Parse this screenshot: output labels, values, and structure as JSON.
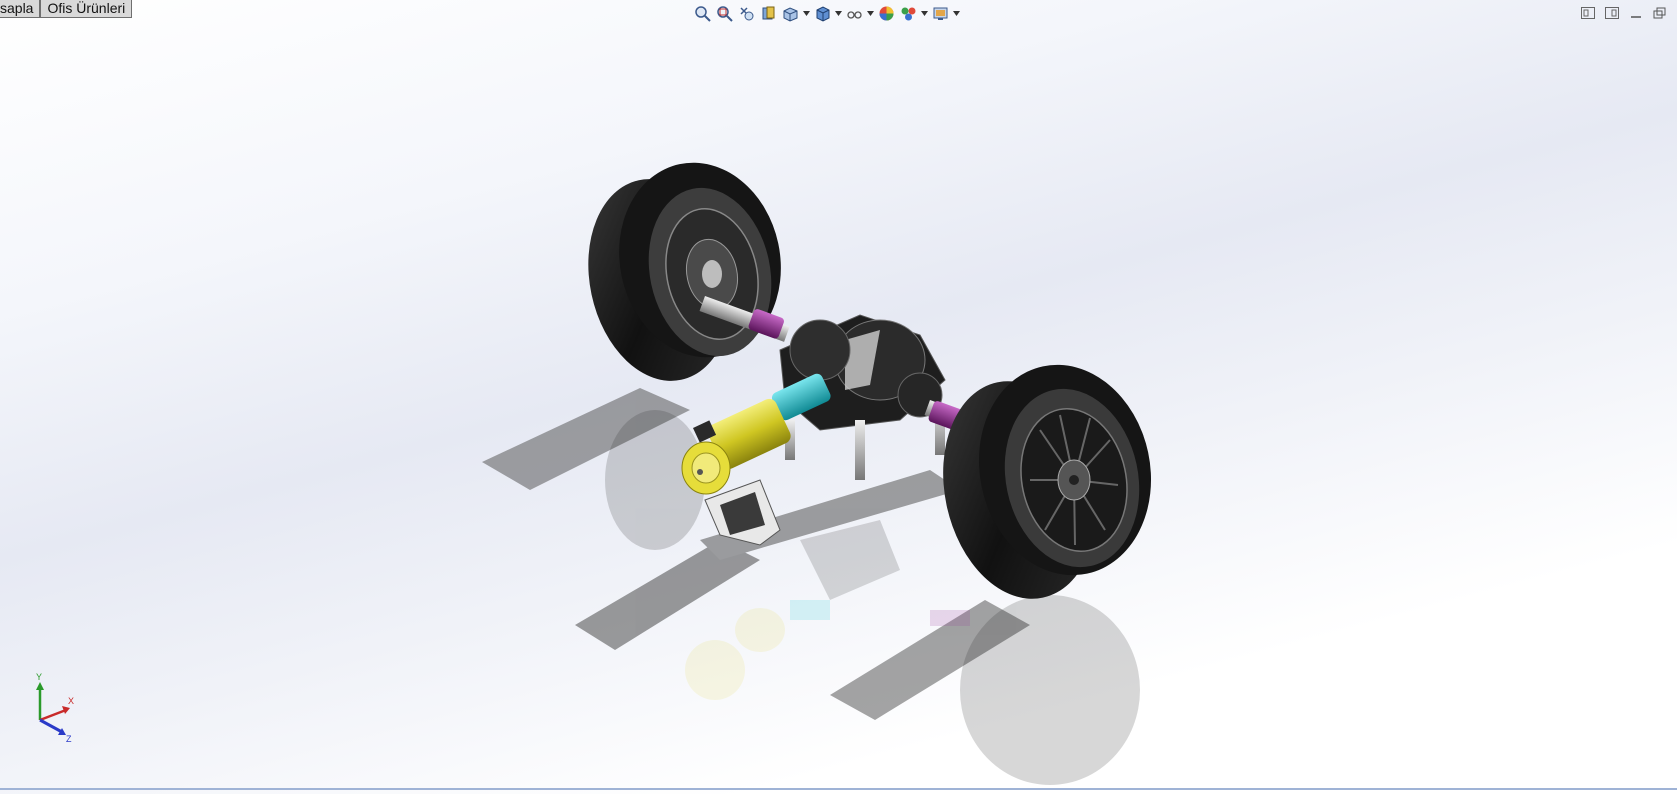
{
  "tabs": [
    {
      "label": "sapla"
    },
    {
      "label": "Ofis Ürünleri"
    }
  ],
  "toolbar": {
    "icons": [
      "zoom-to-fit-icon",
      "zoom-to-area-icon",
      "previous-view-icon",
      "section-view-icon",
      "view-orientation-icon",
      "display-style-icon",
      "hide-show-items-icon",
      "edit-appearance-icon",
      "apply-scene-icon",
      "view-settings-icon"
    ]
  },
  "window_controls": [
    "tile-horizontal-icon",
    "tile-vertical-icon",
    "minimize-icon",
    "restore-icon"
  ],
  "triad": {
    "x": "X",
    "y": "Y",
    "z": "Z"
  },
  "colors": {
    "tire": "#1a1a1a",
    "motor": "#d4cc2a",
    "coupling": "#1fb8c4",
    "ujoint": "#8e2a8e",
    "housing": "#222222"
  }
}
